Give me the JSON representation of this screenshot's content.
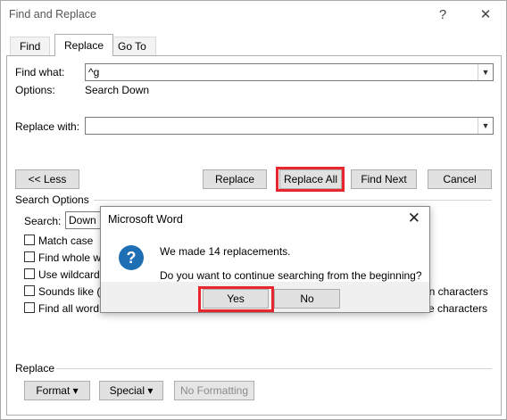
{
  "window": {
    "title": "Find and Replace",
    "help_glyph": "?",
    "close_glyph": "✕"
  },
  "tabs": [
    {
      "label": "Find"
    },
    {
      "label": "Replace"
    },
    {
      "label": "Go To"
    }
  ],
  "find": {
    "label": "Find what:",
    "value": "^g",
    "options_label": "Options:",
    "options_value": "Search Down"
  },
  "replace": {
    "label": "Replace with:",
    "value": ""
  },
  "buttons": {
    "less": "<< Less",
    "replace": "Replace",
    "replace_all": "Replace All",
    "find_next": "Find Next",
    "cancel": "Cancel"
  },
  "search_options": {
    "title": "Search Options",
    "search_label": "Search:",
    "search_value": "Down",
    "checkboxes": [
      {
        "label": "Match case"
      },
      {
        "label": "Find whole wo"
      },
      {
        "label": "Use wildcards"
      },
      {
        "label": "Sounds like (E"
      },
      {
        "label": "Find all word"
      }
    ],
    "right_fragments": [
      {
        "label": "on characters"
      },
      {
        "label": "ce characters"
      }
    ]
  },
  "replace_section": {
    "title": "Replace",
    "format": "Format ▾",
    "special": "Special ▾",
    "no_formatting": "No Formatting"
  },
  "dialog": {
    "title": "Microsoft Word",
    "close_glyph": "✕",
    "icon": "question-icon",
    "icon_glyph": "?",
    "message1": "We made 14 replacements.",
    "message2": "Do you want to continue searching from the beginning?",
    "yes": "Yes",
    "no": "No"
  },
  "colors": {
    "highlight": "#e8262c",
    "question_icon": "#1f6fb5"
  }
}
